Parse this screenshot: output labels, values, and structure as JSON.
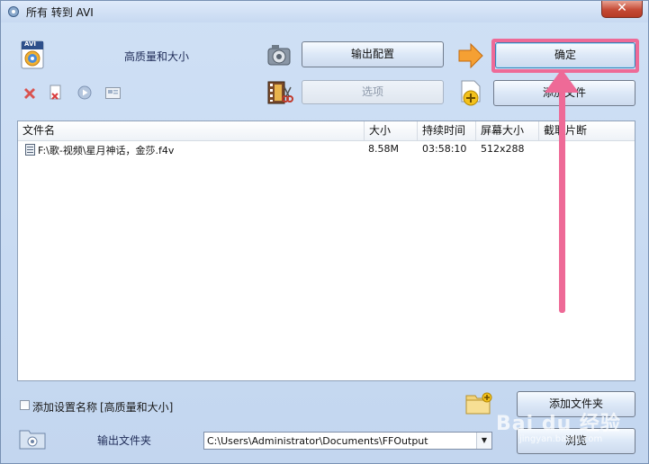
{
  "window": {
    "title": "所有 转到 AVI",
    "close_glyph": "✕"
  },
  "profile": {
    "format_badge": "AVI",
    "quality_label": "高质量和大小"
  },
  "buttons": {
    "output_config": "输出配置",
    "ok": "确定",
    "options": "选项",
    "add_file": "添加文件",
    "add_folder": "添加文件夹",
    "browse": "浏览"
  },
  "file_list": {
    "columns": [
      "文件名",
      "大小",
      "持续时间",
      "屏幕大小",
      "截取片断"
    ],
    "rows": [
      {
        "filename": "F:\\歌-视频\\星月神话，金莎.f4v",
        "size": "8.58M",
        "duration": "03:58:10",
        "screen_size": "512x288",
        "clip": ""
      }
    ]
  },
  "bottom": {
    "add_setting_name_label": "添加设置名称",
    "setting_name_value": "[高质量和大小]",
    "add_setting_checked": false,
    "output_folder_label": "输出文件夹",
    "output_path": "C:\\Users\\Administrator\\Documents\\FFOutput"
  },
  "annotation": {
    "color": "#ee6a97"
  },
  "watermark": {
    "brand": "Bai du 经验",
    "url": "jingyan.baidu.com"
  }
}
